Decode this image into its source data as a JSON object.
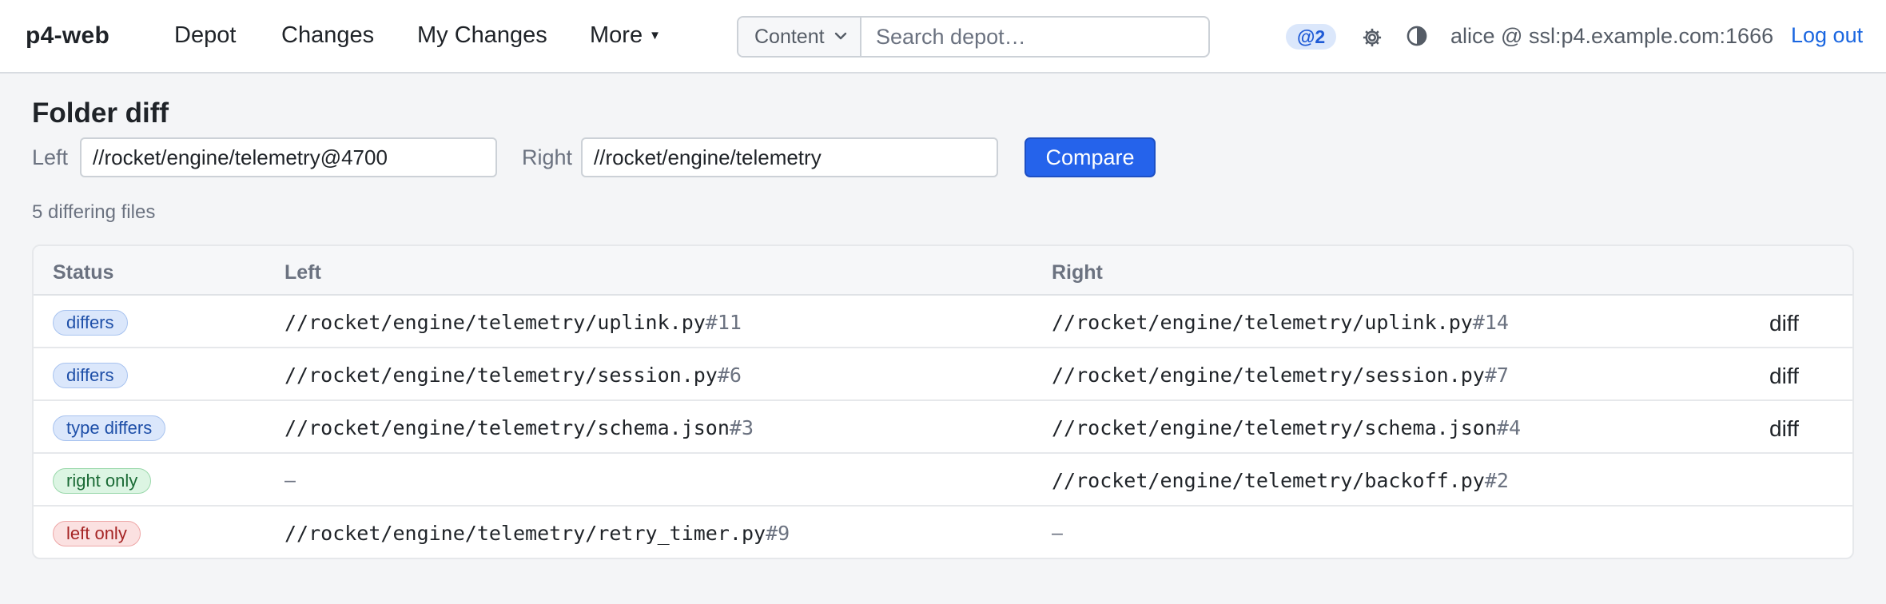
{
  "nav": {
    "brand": "p4-web",
    "links": [
      "Depot",
      "Changes",
      "My Changes",
      "More"
    ],
    "search_scope": "Content",
    "search_placeholder": "Search depot…",
    "pending_badge": "@2",
    "user": "alice @ ssl:p4.example.com:1666",
    "logout": "Log out",
    "icons": {
      "settings": "gear-icon",
      "theme": "contrast-icon",
      "scope": "chevron-down-icon",
      "more": "caret-down-icon"
    }
  },
  "page": {
    "title": "Folder diff",
    "left_label": "Left",
    "left_value": "//rocket/engine/telemetry@4700",
    "right_label": "Right",
    "right_value": "//rocket/engine/telemetry",
    "compare_label": "Compare",
    "count_text": "5 differing files"
  },
  "table": {
    "headers": [
      "Status",
      "Left",
      "Right"
    ],
    "rows": [
      {
        "status": "differs",
        "tone": "blue",
        "left_path": "//rocket/engine/telemetry/uplink.py",
        "left_rev": "#11",
        "right_path": "//rocket/engine/telemetry/uplink.py",
        "right_rev": "#14",
        "action": "diff"
      },
      {
        "status": "differs",
        "tone": "blue",
        "left_path": "//rocket/engine/telemetry/session.py",
        "left_rev": "#6",
        "right_path": "//rocket/engine/telemetry/session.py",
        "right_rev": "#7",
        "action": "diff"
      },
      {
        "status": "type differs",
        "tone": "blue",
        "left_path": "//rocket/engine/telemetry/schema.json",
        "left_rev": "#3",
        "right_path": "//rocket/engine/telemetry/schema.json",
        "right_rev": "#4",
        "action": "diff"
      },
      {
        "status": "right only",
        "tone": "green",
        "left_empty": "–",
        "right_path": "//rocket/engine/telemetry/backoff.py",
        "right_rev": "#2"
      },
      {
        "status": "left only",
        "tone": "red",
        "left_path": "//rocket/engine/telemetry/retry_timer.py",
        "left_rev": "#9",
        "right_empty": "–"
      }
    ]
  },
  "colors": {
    "accent": "#2563eb",
    "link": "#1a66e0"
  }
}
